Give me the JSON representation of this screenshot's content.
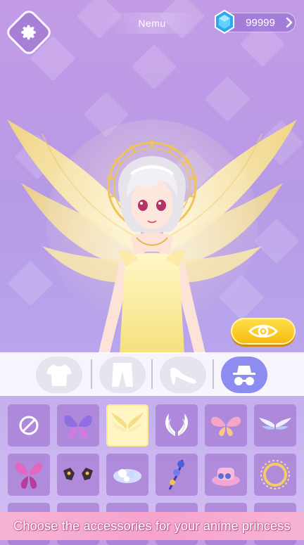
{
  "header": {
    "player_name": "Nemu",
    "gems": "99999",
    "settings_icon": "gear-icon",
    "gem_icon": "blue-gem-icon"
  },
  "preview_button": {
    "icon": "eye-icon"
  },
  "tabs": [
    {
      "name": "tops",
      "icon": "tshirt-icon",
      "active": false
    },
    {
      "name": "bottoms",
      "icon": "pants-icon",
      "active": false
    },
    {
      "name": "shoes",
      "icon": "high-heel-icon",
      "active": false
    },
    {
      "name": "accessories",
      "icon": "hat-glasses-icon",
      "active": true
    }
  ],
  "items": [
    {
      "icon": "none-icon",
      "selected": false
    },
    {
      "icon": "purple-butterfly-wings-icon",
      "selected": false
    },
    {
      "icon": "golden-angel-wings-icon",
      "selected": true
    },
    {
      "icon": "white-angel-wings-icon",
      "selected": false
    },
    {
      "icon": "pink-fairy-wings-icon",
      "selected": false
    },
    {
      "icon": "silver-wings-icon",
      "selected": false
    },
    {
      "icon": "pink-butterfly-wings-icon",
      "selected": false
    },
    {
      "icon": "dark-bat-wings-icon",
      "selected": false
    },
    {
      "icon": "crystal-flower-icon",
      "selected": false
    },
    {
      "icon": "blue-flower-charm-icon",
      "selected": false
    },
    {
      "icon": "pink-mini-hat-icon",
      "selected": false
    },
    {
      "icon": "golden-halo-icon",
      "selected": false
    }
  ],
  "caption": "Choose the accessories for your anime princess",
  "colors": {
    "accent": "#8d8cf1",
    "gold": "#f7b90d",
    "caption_bg": "#f6a3cc"
  }
}
